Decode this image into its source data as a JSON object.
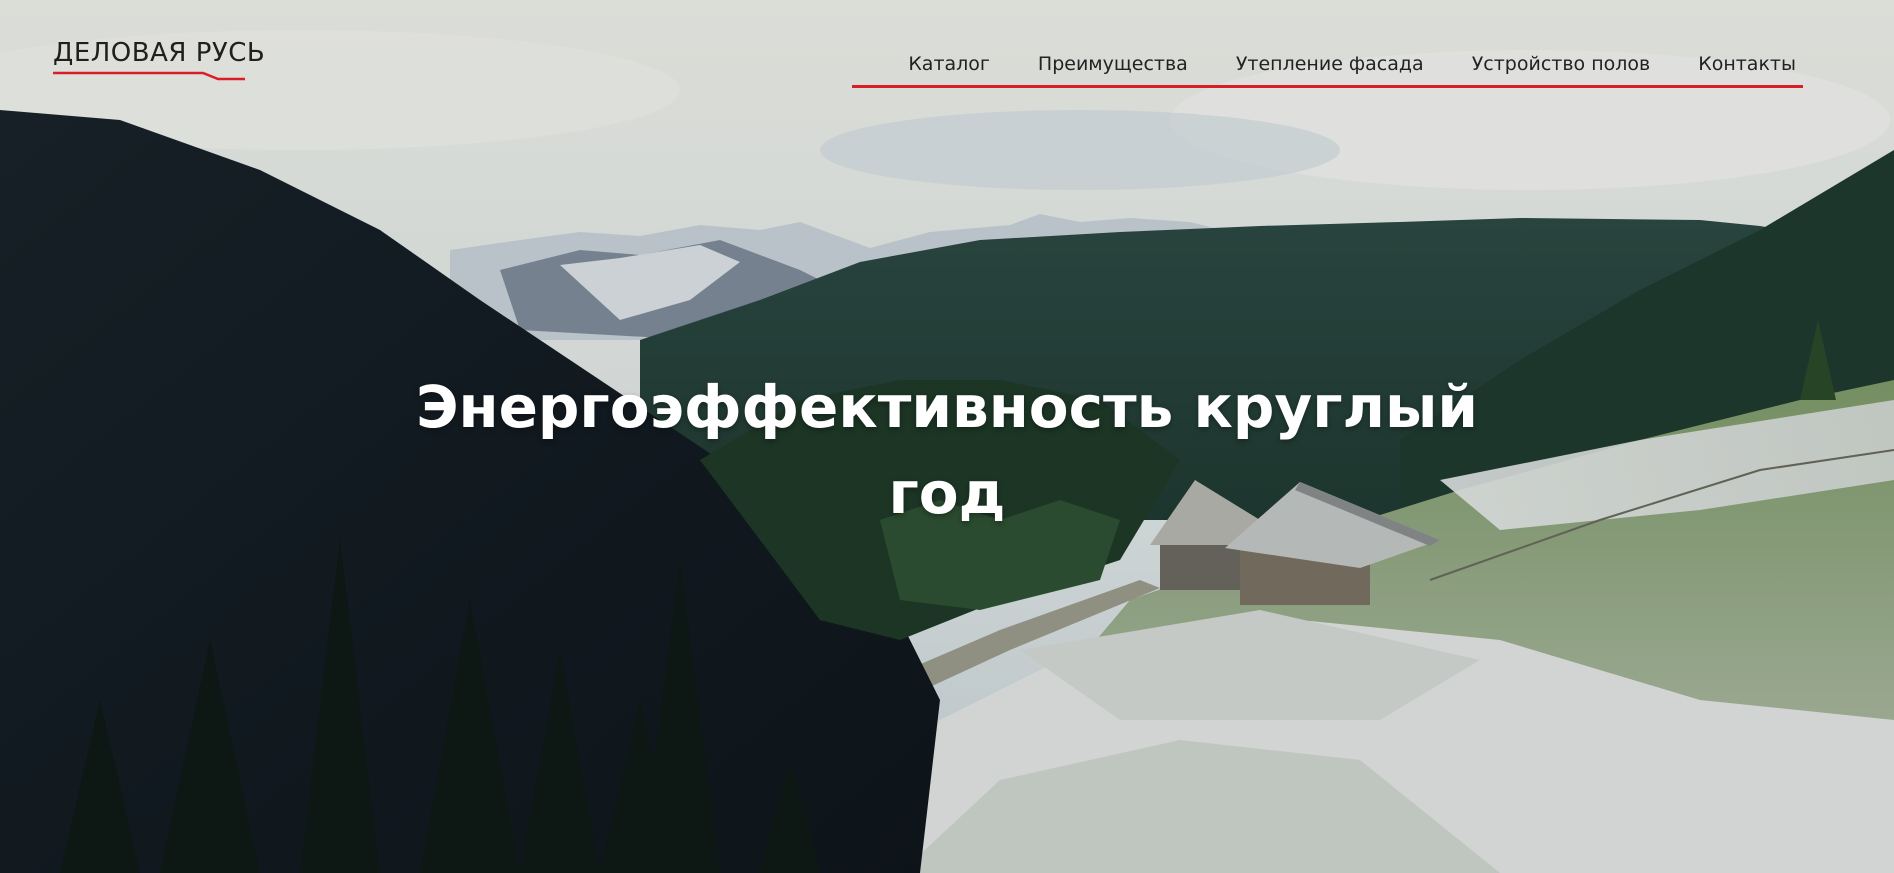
{
  "brand": {
    "name": "ДЕЛОВАЯ РУСЬ",
    "accent_color": "#d81e27"
  },
  "nav": {
    "items": [
      {
        "label": "Каталог"
      },
      {
        "label": "Преимущества"
      },
      {
        "label": "Утепление фасада"
      },
      {
        "label": "Устройство полов"
      },
      {
        "label": "Контакты"
      }
    ]
  },
  "hero": {
    "headline": "Энергоэффективность круглый год",
    "background": "mountain-valley-with-cabins-photo"
  }
}
